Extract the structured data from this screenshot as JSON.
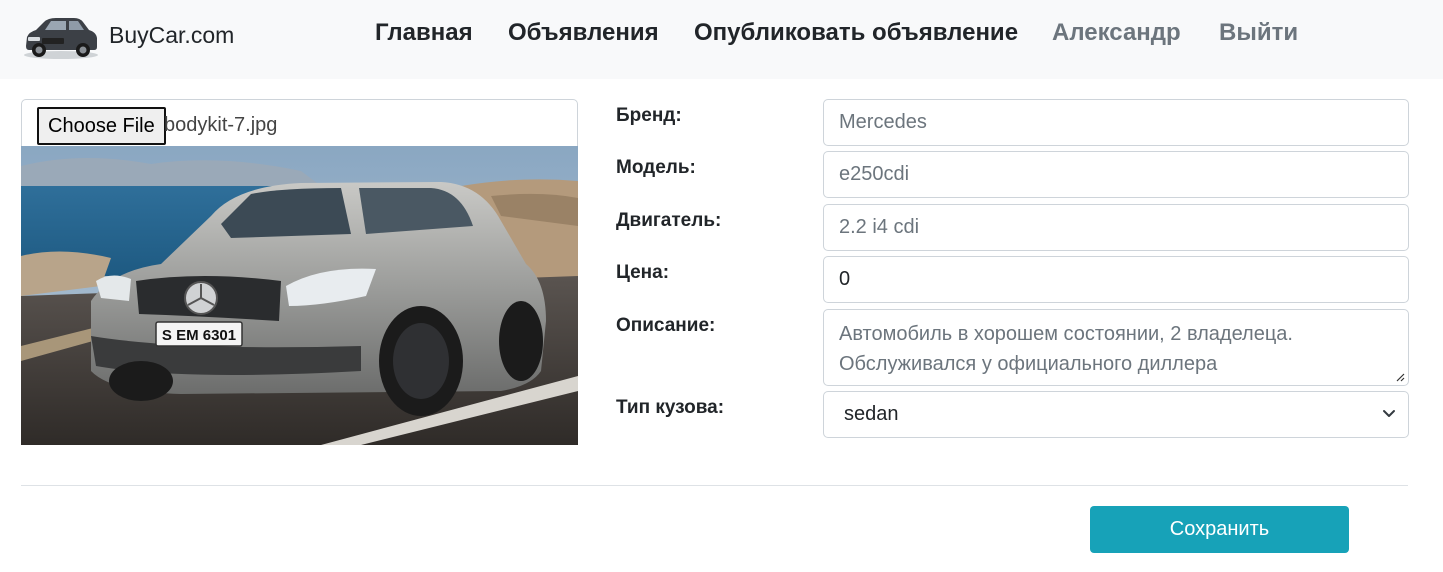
{
  "navbar": {
    "brand": "BuyCar.com",
    "links": [
      {
        "label": "Главная"
      },
      {
        "label": "Объявления"
      },
      {
        "label": "Опубликовать объявление"
      },
      {
        "label": "Александр"
      },
      {
        "label": "Выйти"
      }
    ]
  },
  "upload": {
    "button_label": "Choose File",
    "file_name": "bodykit-7.jpg",
    "plate_text": "S EM 6301"
  },
  "form": {
    "brand_label": "Бренд:",
    "brand_value": "Mercedes",
    "model_label": "Модель:",
    "model_value": "e250cdi",
    "engine_label": "Двигатель:",
    "engine_value": "2.2 i4 cdi",
    "price_label": "Цена:",
    "price_value": "0",
    "description_label": "Описание:",
    "description_value": "Автомобиль в хорошем состоянии, 2 владелеца. Обслуживался у официального диллера",
    "body_type_label": "Тип кузова:",
    "body_type_value": "sedan"
  },
  "actions": {
    "save_label": "Сохранить"
  },
  "colors": {
    "navbar_bg": "#f8f9fa",
    "accent": "#17a2b8",
    "border": "#ced4da",
    "muted": "#6c757d"
  }
}
